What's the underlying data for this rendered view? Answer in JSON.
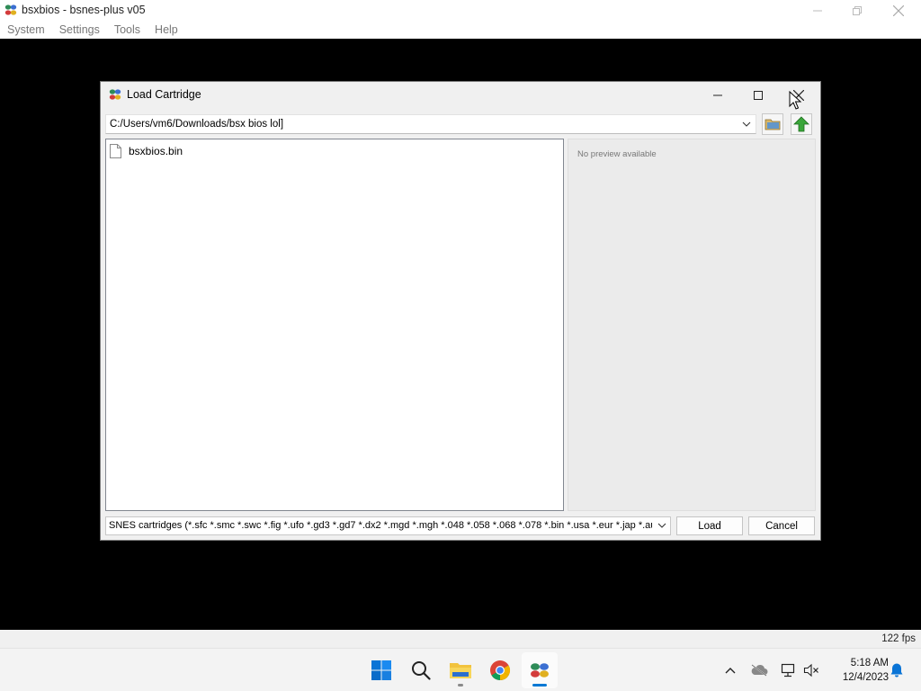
{
  "app": {
    "title": "bsxbios - bsnes-plus v05",
    "menu": [
      "System",
      "Settings",
      "Tools",
      "Help"
    ],
    "fps": "122 fps"
  },
  "dialog": {
    "title": "Load Cartridge",
    "path": "C:/Users/vm6/Downloads/bsx bios lol]",
    "files": [
      {
        "name": "bsxbios.bin",
        "icon": "file-icon"
      }
    ],
    "preview_text": "No preview available",
    "filter": "SNES cartridges (*.sfc *.smc *.swc *.fig *.ufo *.gd3 *.gd7 *.dx2 *.mgd *.mgh *.048 *.058 *.068 *.078 *.bin *.usa *.eur *.jap *.aus *.bsx)",
    "load_label": "Load",
    "cancel_label": "Cancel"
  },
  "taskbar": {
    "time": "5:18 AM",
    "date": "12/4/2023",
    "apps": [
      "start-icon",
      "search-icon",
      "file-explorer-icon",
      "chrome-icon",
      "bsnes-icon"
    ],
    "tray": [
      "chevron-up-icon",
      "onedrive-icon",
      "network-icon",
      "volume-muted-icon",
      "notification-bell-icon"
    ]
  },
  "colors": {
    "accent": "#0078d4",
    "folder_up": "#3aa63a"
  }
}
